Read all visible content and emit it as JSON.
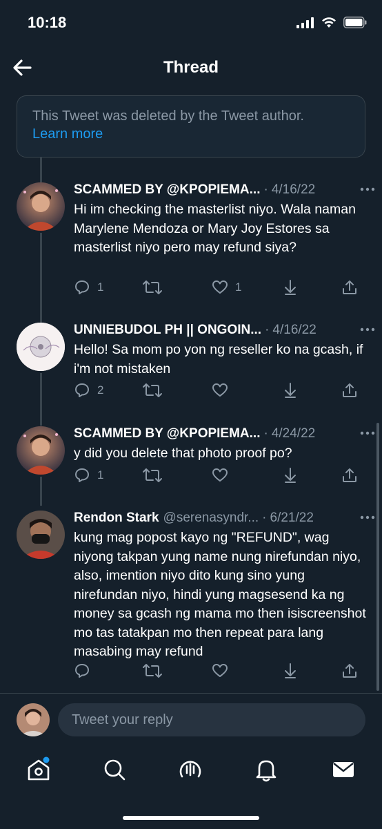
{
  "status": {
    "time": "10:18"
  },
  "nav": {
    "title": "Thread"
  },
  "deleted": {
    "text": "This Tweet was deleted by the Tweet author.",
    "link": "Learn more"
  },
  "tweets": [
    {
      "name": "SCAMMED BY @KPOPIEMA...",
      "handle": "",
      "sep": "·",
      "date": "4/16/22",
      "body": "Hi im checking the masterlist niyo. Wala naman Marylene Mendoza or Mary Joy Estores sa masterlist niyo pero may refund siya?",
      "replies": "1",
      "retweets": "",
      "likes": "1"
    },
    {
      "name": "UNNIEBUDOL PH || ONGOIN...",
      "handle": "",
      "sep": "·",
      "date": "4/16/22",
      "body": "Hello! Sa mom po yon ng reseller ko na gcash, if i'm not mistaken",
      "replies": "2",
      "retweets": "",
      "likes": ""
    },
    {
      "name": "SCAMMED BY @KPOPIEMA...",
      "handle": "",
      "sep": "·",
      "date": "4/24/22",
      "body": "y did you delete that photo proof po?",
      "replies": "1",
      "retweets": "",
      "likes": ""
    },
    {
      "name": "Rendon Stark",
      "handle": "@serenasyndr...",
      "sep": "·",
      "date": "6/21/22",
      "body": "kung mag popost kayo ng \"REFUND\", wag niyong takpan yung name nung nirefundan niyo, also, imention niyo dito kung sino yung nirefundan niyo, hindi yung magsesend ka ng money sa gcash ng mama mo then isiscreenshot mo tas tatakpan mo then repeat para lang masabing may refund",
      "replies": "",
      "retweets": "",
      "likes": ""
    }
  ],
  "reply": {
    "placeholder": "Tweet your reply"
  },
  "tabs": [
    "home-icon",
    "search-icon",
    "spaces-icon",
    "notifications-icon",
    "messages-icon"
  ],
  "colors": {
    "background": "#15202b",
    "accent": "#1d9bf0",
    "muted": "#8b98a5",
    "line": "#38444d"
  }
}
